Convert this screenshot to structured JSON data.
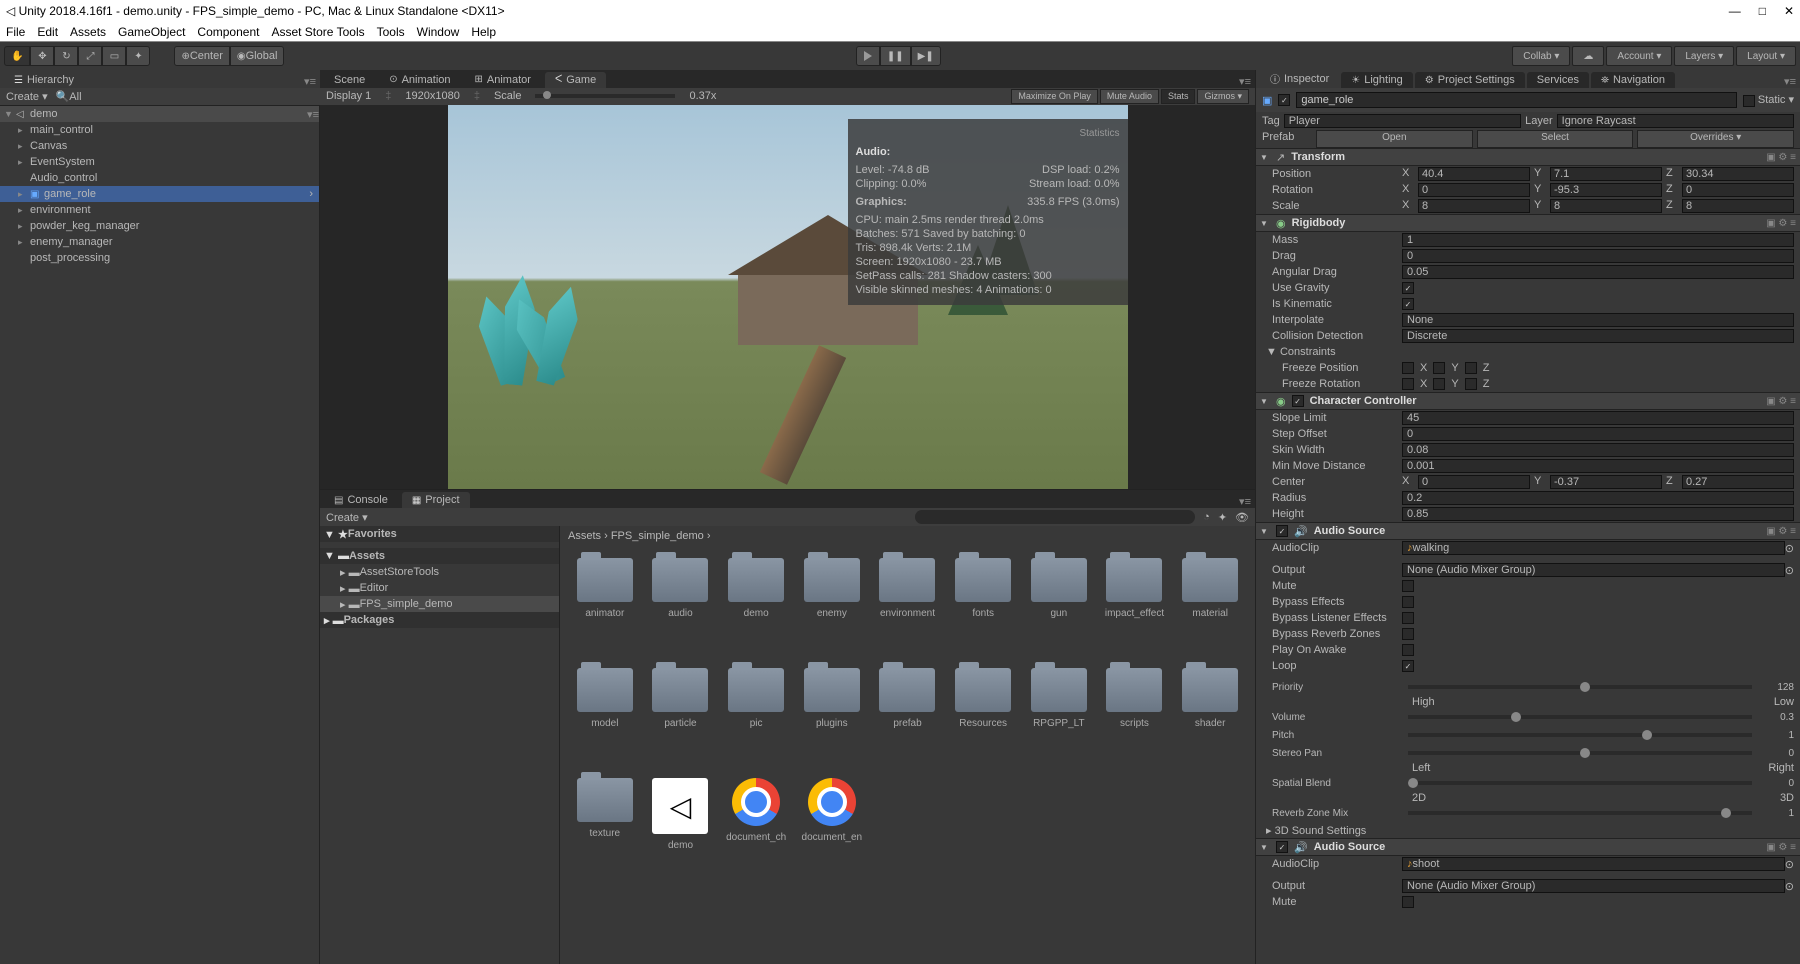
{
  "title": "Unity 2018.4.16f1 - demo.unity - FPS_simple_demo - PC, Mac & Linux Standalone <DX11>",
  "menu": [
    "File",
    "Edit",
    "Assets",
    "GameObject",
    "Component",
    "Asset Store Tools",
    "Tools",
    "Window",
    "Help"
  ],
  "toolbar": {
    "center_label": "Center",
    "global_label": "Global",
    "collab": "Collab ▾",
    "account": "Account ▾",
    "layers": "Layers ▾",
    "layout": "Layout ▾"
  },
  "hierarchy": {
    "tab": "Hierarchy",
    "create": "Create ▾",
    "search_label": "All",
    "root": "demo",
    "items": [
      "main_control",
      "Canvas",
      "EventSystem",
      "Audio_control",
      "game_role",
      "environment",
      "powder_keg_manager",
      "enemy_manager",
      "post_processing"
    ],
    "selected": "game_role"
  },
  "scene_tabs": {
    "scene": "Scene",
    "animation": "Animation",
    "animator": "Animator",
    "game": "Game"
  },
  "game_bar": {
    "display": "Display 1",
    "res": "1920x1080",
    "scale": "Scale",
    "scale_val": "0.37x",
    "maximize": "Maximize On Play",
    "mute": "Mute Audio",
    "stats": "Stats",
    "gizmos": "Gizmos ▾"
  },
  "stats": {
    "title": "Statistics",
    "audio_hd": "Audio:",
    "audio": {
      "level": "Level: -74.8 dB",
      "clipping": "Clipping: 0.0%",
      "dsp": "DSP load: 0.2%",
      "stream": "Stream load: 0.0%"
    },
    "graphics_hd": "Graphics:",
    "fps": "335.8 FPS (3.0ms)",
    "cpu": "CPU: main 2.5ms   render thread 2.0ms",
    "batches": "Batches: 571        Saved by batching: 0",
    "tris": "Tris: 898.4k           Verts: 2.1M",
    "screen": "Screen: 1920x1080 - 23.7 MB",
    "setpass": "SetPass calls: 281    Shadow casters: 300",
    "skinned": "Visible skinned meshes: 4   Animations: 0"
  },
  "project": {
    "console": "Console",
    "project": "Project",
    "create": "Create ▾",
    "favorites": "Favorites",
    "assets": "Assets",
    "tree": [
      "AssetStoreTools",
      "Editor",
      "FPS_simple_demo"
    ],
    "packages": "Packages",
    "breadcrumb": {
      "p1": "Assets",
      "sep": "›",
      "p2": "FPS_simple_demo",
      "sep2": "›"
    },
    "folders": [
      "animator",
      "audio",
      "demo",
      "enemy",
      "environment",
      "fonts",
      "gun",
      "impact_effect",
      "material",
      "model",
      "particle",
      "pic",
      "plugins",
      "prefab",
      "Resources",
      "RPGPP_LT",
      "scripts",
      "shader",
      "texture"
    ],
    "files": [
      {
        "name": "demo",
        "type": "unity"
      },
      {
        "name": "document_ch",
        "type": "chrome"
      },
      {
        "name": "document_en",
        "type": "chrome"
      }
    ]
  },
  "inspector": {
    "tab": "Inspector",
    "lighting": "Lighting",
    "projsettings": "Project Settings",
    "services": "Services",
    "navigation": "Navigation",
    "name": "game_role",
    "static": "Static ▾",
    "tag_lbl": "Tag",
    "tag": "Player",
    "layer_lbl": "Layer",
    "layer": "Ignore Raycast",
    "prefab_lbl": "Prefab",
    "open": "Open",
    "select": "Select",
    "overrides": "Overrides ▾",
    "transform": {
      "title": "Transform",
      "pos": "Position",
      "rot": "Rotation",
      "scale": "Scale",
      "px": "40.4",
      "py": "7.1",
      "pz": "30.34",
      "rx": "0",
      "ry": "-95.3",
      "rz": "0",
      "sx": "8",
      "sy": "8",
      "sz": "8"
    },
    "rigidbody": {
      "title": "Rigidbody",
      "mass": "Mass",
      "mass_v": "1",
      "drag": "Drag",
      "drag_v": "0",
      "adrag": "Angular Drag",
      "adrag_v": "0.05",
      "gravity": "Use Gravity",
      "kinematic": "Is Kinematic",
      "interp": "Interpolate",
      "interp_v": "None",
      "coll": "Collision Detection",
      "coll_v": "Discrete",
      "constraints": "Constraints",
      "freeze_pos": "Freeze Position",
      "freeze_rot": "Freeze Rotation"
    },
    "cc": {
      "title": "Character Controller",
      "slope": "Slope Limit",
      "slope_v": "45",
      "step": "Step Offset",
      "step_v": "0",
      "skin": "Skin Width",
      "skin_v": "0.08",
      "minmove": "Min Move Distance",
      "minmove_v": "0.001",
      "center": "Center",
      "cx": "0",
      "cy": "-0.37",
      "cz": "0.27",
      "radius": "Radius",
      "radius_v": "0.2",
      "height": "Height",
      "height_v": "0.85"
    },
    "audiosrc": {
      "title": "Audio Source",
      "clip": "AudioClip",
      "clip_v": "walking",
      "output": "Output",
      "output_v": "None (Audio Mixer Group)",
      "mute": "Mute",
      "bypass": "Bypass Effects",
      "bypassl": "Bypass Listener Effects",
      "bypassr": "Bypass Reverb Zones",
      "awake": "Play On Awake",
      "loop": "Loop",
      "priority": "Priority",
      "priority_v": "128",
      "pri_l": "High",
      "pri_r": "Low",
      "volume": "Volume",
      "volume_v": "0.3",
      "pitch": "Pitch",
      "pitch_v": "1",
      "stereo": "Stereo Pan",
      "stereo_v": "0",
      "st_l": "Left",
      "st_r": "Right",
      "blend": "Spatial Blend",
      "blend_v": "0",
      "bl_l": "2D",
      "bl_r": "3D",
      "reverb": "Reverb Zone Mix",
      "reverb_v": "1",
      "threed": "3D Sound Settings"
    },
    "audiosrc2": {
      "title": "Audio Source",
      "clip": "AudioClip",
      "clip_v": "shoot",
      "output": "Output",
      "output_v": "None (Audio Mixer Group)",
      "mute": "Mute"
    }
  }
}
